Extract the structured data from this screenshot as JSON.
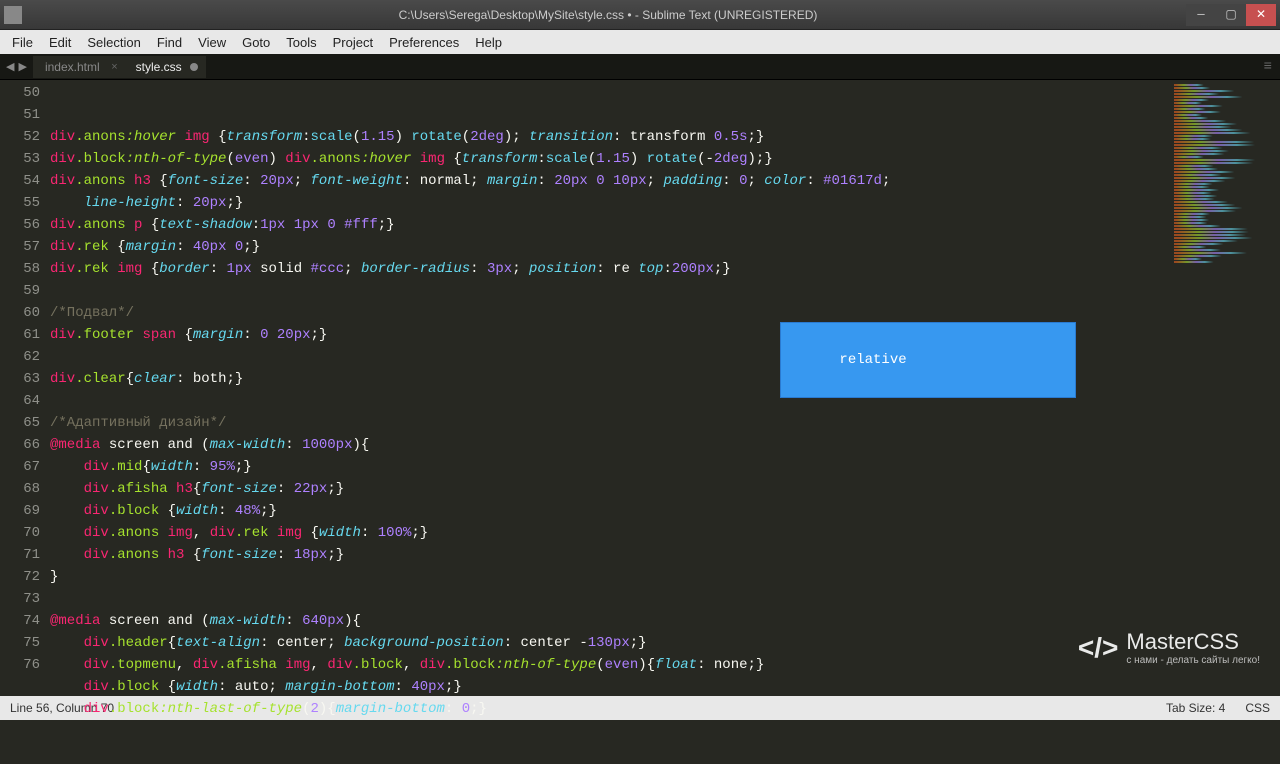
{
  "window": {
    "title": "C:\\Users\\Serega\\Desktop\\MySite\\style.css • - Sublime Text (UNREGISTERED)"
  },
  "menu": {
    "items": [
      "File",
      "Edit",
      "Selection",
      "Find",
      "View",
      "Goto",
      "Tools",
      "Project",
      "Preferences",
      "Help"
    ]
  },
  "tabs": {
    "items": [
      {
        "label": "index.html",
        "active": false,
        "dirty": false
      },
      {
        "label": "style.css",
        "active": true,
        "dirty": true
      }
    ]
  },
  "autocomplete": {
    "suggestion": "relative"
  },
  "gutter": {
    "start": 50,
    "end": 76
  },
  "code": {
    "lines": [
      {
        "n": 50,
        "tokens": [
          [
            "c-tag",
            "div"
          ],
          [
            "c-sel",
            ".anons"
          ],
          [
            "c-pseudo",
            ":hover"
          ],
          [
            "c-punc",
            " "
          ],
          [
            "c-tag",
            "img"
          ],
          [
            "c-punc",
            " {"
          ],
          [
            "c-prop",
            "transform"
          ],
          [
            "c-punc",
            ":"
          ],
          [
            "c-func",
            "scale"
          ],
          [
            "c-punc",
            "("
          ],
          [
            "c-num",
            "1.15"
          ],
          [
            "c-punc",
            ") "
          ],
          [
            "c-func",
            "rotate"
          ],
          [
            "c-punc",
            "("
          ],
          [
            "c-num",
            "2deg"
          ],
          [
            "c-punc",
            "); "
          ],
          [
            "c-prop",
            "transition"
          ],
          [
            "c-punc",
            ": transform "
          ],
          [
            "c-num",
            "0.5s"
          ],
          [
            "c-punc",
            ";}"
          ]
        ]
      },
      {
        "n": 51,
        "tokens": [
          [
            "c-tag",
            "div"
          ],
          [
            "c-sel",
            ".block"
          ],
          [
            "c-pseudo",
            ":nth-of-type"
          ],
          [
            "c-punc",
            "("
          ],
          [
            "c-num",
            "even"
          ],
          [
            "c-punc",
            ") "
          ],
          [
            "c-tag",
            "div"
          ],
          [
            "c-sel",
            ".anons"
          ],
          [
            "c-pseudo",
            ":hover"
          ],
          [
            "c-punc",
            " "
          ],
          [
            "c-tag",
            "img"
          ],
          [
            "c-punc",
            " {"
          ],
          [
            "c-prop",
            "transform"
          ],
          [
            "c-punc",
            ":"
          ],
          [
            "c-func",
            "scale"
          ],
          [
            "c-punc",
            "("
          ],
          [
            "c-num",
            "1.15"
          ],
          [
            "c-punc",
            ") "
          ],
          [
            "c-func",
            "rotate"
          ],
          [
            "c-punc",
            "(-"
          ],
          [
            "c-num",
            "2deg"
          ],
          [
            "c-punc",
            ");}"
          ]
        ]
      },
      {
        "n": 52,
        "tokens": [
          [
            "c-tag",
            "div"
          ],
          [
            "c-sel",
            ".anons"
          ],
          [
            "c-punc",
            " "
          ],
          [
            "c-tag",
            "h3"
          ],
          [
            "c-punc",
            " {"
          ],
          [
            "c-prop",
            "font-size"
          ],
          [
            "c-punc",
            ": "
          ],
          [
            "c-num",
            "20px"
          ],
          [
            "c-punc",
            "; "
          ],
          [
            "c-prop",
            "font-weight"
          ],
          [
            "c-punc",
            ": normal; "
          ],
          [
            "c-prop",
            "margin"
          ],
          [
            "c-punc",
            ": "
          ],
          [
            "c-num",
            "20px"
          ],
          [
            "c-punc",
            " "
          ],
          [
            "c-num",
            "0"
          ],
          [
            "c-punc",
            " "
          ],
          [
            "c-num",
            "10px"
          ],
          [
            "c-punc",
            "; "
          ],
          [
            "c-prop",
            "padding"
          ],
          [
            "c-punc",
            ": "
          ],
          [
            "c-num",
            "0"
          ],
          [
            "c-punc",
            "; "
          ],
          [
            "c-prop",
            "color"
          ],
          [
            "c-punc",
            ": "
          ],
          [
            "c-num",
            "#01617d"
          ],
          [
            "c-punc",
            ";"
          ]
        ]
      },
      {
        "n": 53,
        "tokens": [
          [
            "c-punc",
            "    "
          ],
          [
            "c-prop",
            "line-height"
          ],
          [
            "c-punc",
            ": "
          ],
          [
            "c-num",
            "20px"
          ],
          [
            "c-punc",
            ";}"
          ]
        ]
      },
      {
        "n": 54,
        "tokens": [
          [
            "c-tag",
            "div"
          ],
          [
            "c-sel",
            ".anons"
          ],
          [
            "c-punc",
            " "
          ],
          [
            "c-tag",
            "p"
          ],
          [
            "c-punc",
            " {"
          ],
          [
            "c-prop",
            "text-shadow"
          ],
          [
            "c-punc",
            ":"
          ],
          [
            "c-num",
            "1px"
          ],
          [
            "c-punc",
            " "
          ],
          [
            "c-num",
            "1px"
          ],
          [
            "c-punc",
            " "
          ],
          [
            "c-num",
            "0"
          ],
          [
            "c-punc",
            " "
          ],
          [
            "c-num",
            "#fff"
          ],
          [
            "c-punc",
            ";}"
          ]
        ]
      },
      {
        "n": 55,
        "tokens": [
          [
            "c-tag",
            "div"
          ],
          [
            "c-sel",
            ".rek"
          ],
          [
            "c-punc",
            " {"
          ],
          [
            "c-prop",
            "margin"
          ],
          [
            "c-punc",
            ": "
          ],
          [
            "c-num",
            "40px"
          ],
          [
            "c-punc",
            " "
          ],
          [
            "c-num",
            "0"
          ],
          [
            "c-punc",
            ";}"
          ]
        ]
      },
      {
        "n": 56,
        "tokens": [
          [
            "c-tag",
            "div"
          ],
          [
            "c-sel",
            ".rek"
          ],
          [
            "c-punc",
            " "
          ],
          [
            "c-tag",
            "img"
          ],
          [
            "c-punc",
            " {"
          ],
          [
            "c-prop",
            "border"
          ],
          [
            "c-punc",
            ": "
          ],
          [
            "c-num",
            "1px"
          ],
          [
            "c-punc",
            " solid "
          ],
          [
            "c-num",
            "#ccc"
          ],
          [
            "c-punc",
            "; "
          ],
          [
            "c-prop",
            "border-radius"
          ],
          [
            "c-punc",
            ": "
          ],
          [
            "c-num",
            "3px"
          ],
          [
            "c-punc",
            "; "
          ],
          [
            "c-prop",
            "position"
          ],
          [
            "c-punc",
            ": re "
          ],
          [
            "c-prop",
            "top"
          ],
          [
            "c-punc",
            ":"
          ],
          [
            "c-num",
            "200px"
          ],
          [
            "c-punc",
            ";}"
          ]
        ]
      },
      {
        "n": 57,
        "tokens": []
      },
      {
        "n": 58,
        "tokens": [
          [
            "c-comment",
            "/*Подвал*/"
          ]
        ]
      },
      {
        "n": 59,
        "tokens": [
          [
            "c-tag",
            "div"
          ],
          [
            "c-sel",
            ".footer"
          ],
          [
            "c-punc",
            " "
          ],
          [
            "c-tag",
            "span"
          ],
          [
            "c-punc",
            " {"
          ],
          [
            "c-prop",
            "margin"
          ],
          [
            "c-punc",
            ": "
          ],
          [
            "c-num",
            "0"
          ],
          [
            "c-punc",
            " "
          ],
          [
            "c-num",
            "20px"
          ],
          [
            "c-punc",
            ";}"
          ]
        ]
      },
      {
        "n": 60,
        "tokens": []
      },
      {
        "n": 61,
        "tokens": [
          [
            "c-tag",
            "div"
          ],
          [
            "c-sel",
            ".clear"
          ],
          [
            "c-punc",
            "{"
          ],
          [
            "c-prop",
            "clear"
          ],
          [
            "c-punc",
            ": both;}"
          ]
        ]
      },
      {
        "n": 62,
        "tokens": []
      },
      {
        "n": 63,
        "tokens": [
          [
            "c-comment",
            "/*Адаптивный дизайн*/"
          ]
        ]
      },
      {
        "n": 64,
        "tokens": [
          [
            "c-at",
            "@media"
          ],
          [
            "c-punc",
            " screen and ("
          ],
          [
            "c-prop",
            "max-width"
          ],
          [
            "c-punc",
            ": "
          ],
          [
            "c-num",
            "1000px"
          ],
          [
            "c-punc",
            "){"
          ]
        ]
      },
      {
        "n": 65,
        "tokens": [
          [
            "c-punc",
            "    "
          ],
          [
            "c-tag",
            "div"
          ],
          [
            "c-sel",
            ".mid"
          ],
          [
            "c-punc",
            "{"
          ],
          [
            "c-prop",
            "width"
          ],
          [
            "c-punc",
            ": "
          ],
          [
            "c-num",
            "95%"
          ],
          [
            "c-punc",
            ";}"
          ]
        ]
      },
      {
        "n": 66,
        "tokens": [
          [
            "c-punc",
            "    "
          ],
          [
            "c-tag",
            "div"
          ],
          [
            "c-sel",
            ".afisha"
          ],
          [
            "c-punc",
            " "
          ],
          [
            "c-tag",
            "h3"
          ],
          [
            "c-punc",
            "{"
          ],
          [
            "c-prop",
            "font-size"
          ],
          [
            "c-punc",
            ": "
          ],
          [
            "c-num",
            "22px"
          ],
          [
            "c-punc",
            ";}"
          ]
        ]
      },
      {
        "n": 67,
        "tokens": [
          [
            "c-punc",
            "    "
          ],
          [
            "c-tag",
            "div"
          ],
          [
            "c-sel",
            ".block"
          ],
          [
            "c-punc",
            " {"
          ],
          [
            "c-prop",
            "width"
          ],
          [
            "c-punc",
            ": "
          ],
          [
            "c-num",
            "48%"
          ],
          [
            "c-punc",
            ";}"
          ]
        ]
      },
      {
        "n": 68,
        "tokens": [
          [
            "c-punc",
            "    "
          ],
          [
            "c-tag",
            "div"
          ],
          [
            "c-sel",
            ".anons"
          ],
          [
            "c-punc",
            " "
          ],
          [
            "c-tag",
            "img"
          ],
          [
            "c-punc",
            ", "
          ],
          [
            "c-tag",
            "div"
          ],
          [
            "c-sel",
            ".rek"
          ],
          [
            "c-punc",
            " "
          ],
          [
            "c-tag",
            "img"
          ],
          [
            "c-punc",
            " {"
          ],
          [
            "c-prop",
            "width"
          ],
          [
            "c-punc",
            ": "
          ],
          [
            "c-num",
            "100%"
          ],
          [
            "c-punc",
            ";}"
          ]
        ]
      },
      {
        "n": 69,
        "tokens": [
          [
            "c-punc",
            "    "
          ],
          [
            "c-tag",
            "div"
          ],
          [
            "c-sel",
            ".anons"
          ],
          [
            "c-punc",
            " "
          ],
          [
            "c-tag",
            "h3"
          ],
          [
            "c-punc",
            " {"
          ],
          [
            "c-prop",
            "font-size"
          ],
          [
            "c-punc",
            ": "
          ],
          [
            "c-num",
            "18px"
          ],
          [
            "c-punc",
            ";}"
          ]
        ]
      },
      {
        "n": 70,
        "tokens": [
          [
            "c-punc",
            "}"
          ]
        ]
      },
      {
        "n": 71,
        "tokens": []
      },
      {
        "n": 72,
        "tokens": [
          [
            "c-at",
            "@media"
          ],
          [
            "c-punc",
            " screen and ("
          ],
          [
            "c-prop",
            "max-width"
          ],
          [
            "c-punc",
            ": "
          ],
          [
            "c-num",
            "640px"
          ],
          [
            "c-punc",
            "){"
          ]
        ]
      },
      {
        "n": 73,
        "tokens": [
          [
            "c-punc",
            "    "
          ],
          [
            "c-tag",
            "div"
          ],
          [
            "c-sel",
            ".header"
          ],
          [
            "c-punc",
            "{"
          ],
          [
            "c-prop",
            "text-align"
          ],
          [
            "c-punc",
            ": center; "
          ],
          [
            "c-prop",
            "background-position"
          ],
          [
            "c-punc",
            ": center -"
          ],
          [
            "c-num",
            "130px"
          ],
          [
            "c-punc",
            ";}"
          ]
        ]
      },
      {
        "n": 74,
        "tokens": [
          [
            "c-punc",
            "    "
          ],
          [
            "c-tag",
            "div"
          ],
          [
            "c-sel",
            ".topmenu"
          ],
          [
            "c-punc",
            ", "
          ],
          [
            "c-tag",
            "div"
          ],
          [
            "c-sel",
            ".afisha"
          ],
          [
            "c-punc",
            " "
          ],
          [
            "c-tag",
            "img"
          ],
          [
            "c-punc",
            ", "
          ],
          [
            "c-tag",
            "div"
          ],
          [
            "c-sel",
            ".block"
          ],
          [
            "c-punc",
            ", "
          ],
          [
            "c-tag",
            "div"
          ],
          [
            "c-sel",
            ".block"
          ],
          [
            "c-pseudo",
            ":nth-of-type"
          ],
          [
            "c-punc",
            "("
          ],
          [
            "c-num",
            "even"
          ],
          [
            "c-punc",
            "){"
          ],
          [
            "c-prop",
            "float"
          ],
          [
            "c-punc",
            ": none;}"
          ]
        ]
      },
      {
        "n": 75,
        "tokens": [
          [
            "c-punc",
            "    "
          ],
          [
            "c-tag",
            "div"
          ],
          [
            "c-sel",
            ".block"
          ],
          [
            "c-punc",
            " {"
          ],
          [
            "c-prop",
            "width"
          ],
          [
            "c-punc",
            ": auto; "
          ],
          [
            "c-prop",
            "margin-bottom"
          ],
          [
            "c-punc",
            ": "
          ],
          [
            "c-num",
            "40px"
          ],
          [
            "c-punc",
            ";}"
          ]
        ]
      },
      {
        "n": 76,
        "tokens": [
          [
            "c-punc",
            "    "
          ],
          [
            "c-tag",
            "div"
          ],
          [
            "c-sel",
            ".block"
          ],
          [
            "c-pseudo",
            ":nth-last-of-type"
          ],
          [
            "c-punc",
            "("
          ],
          [
            "c-num",
            "2"
          ],
          [
            "c-punc",
            "){"
          ],
          [
            "c-prop",
            "margin-bottom"
          ],
          [
            "c-punc",
            ": "
          ],
          [
            "c-num",
            "0"
          ],
          [
            "c-punc",
            ";}"
          ]
        ]
      }
    ]
  },
  "status": {
    "left": "Line 56, Column 70",
    "tabsize": "Tab Size: 4",
    "syntax": "CSS"
  },
  "watermark": {
    "title": "MasterCSS",
    "sub": "с нами - делать сайты легко!"
  }
}
